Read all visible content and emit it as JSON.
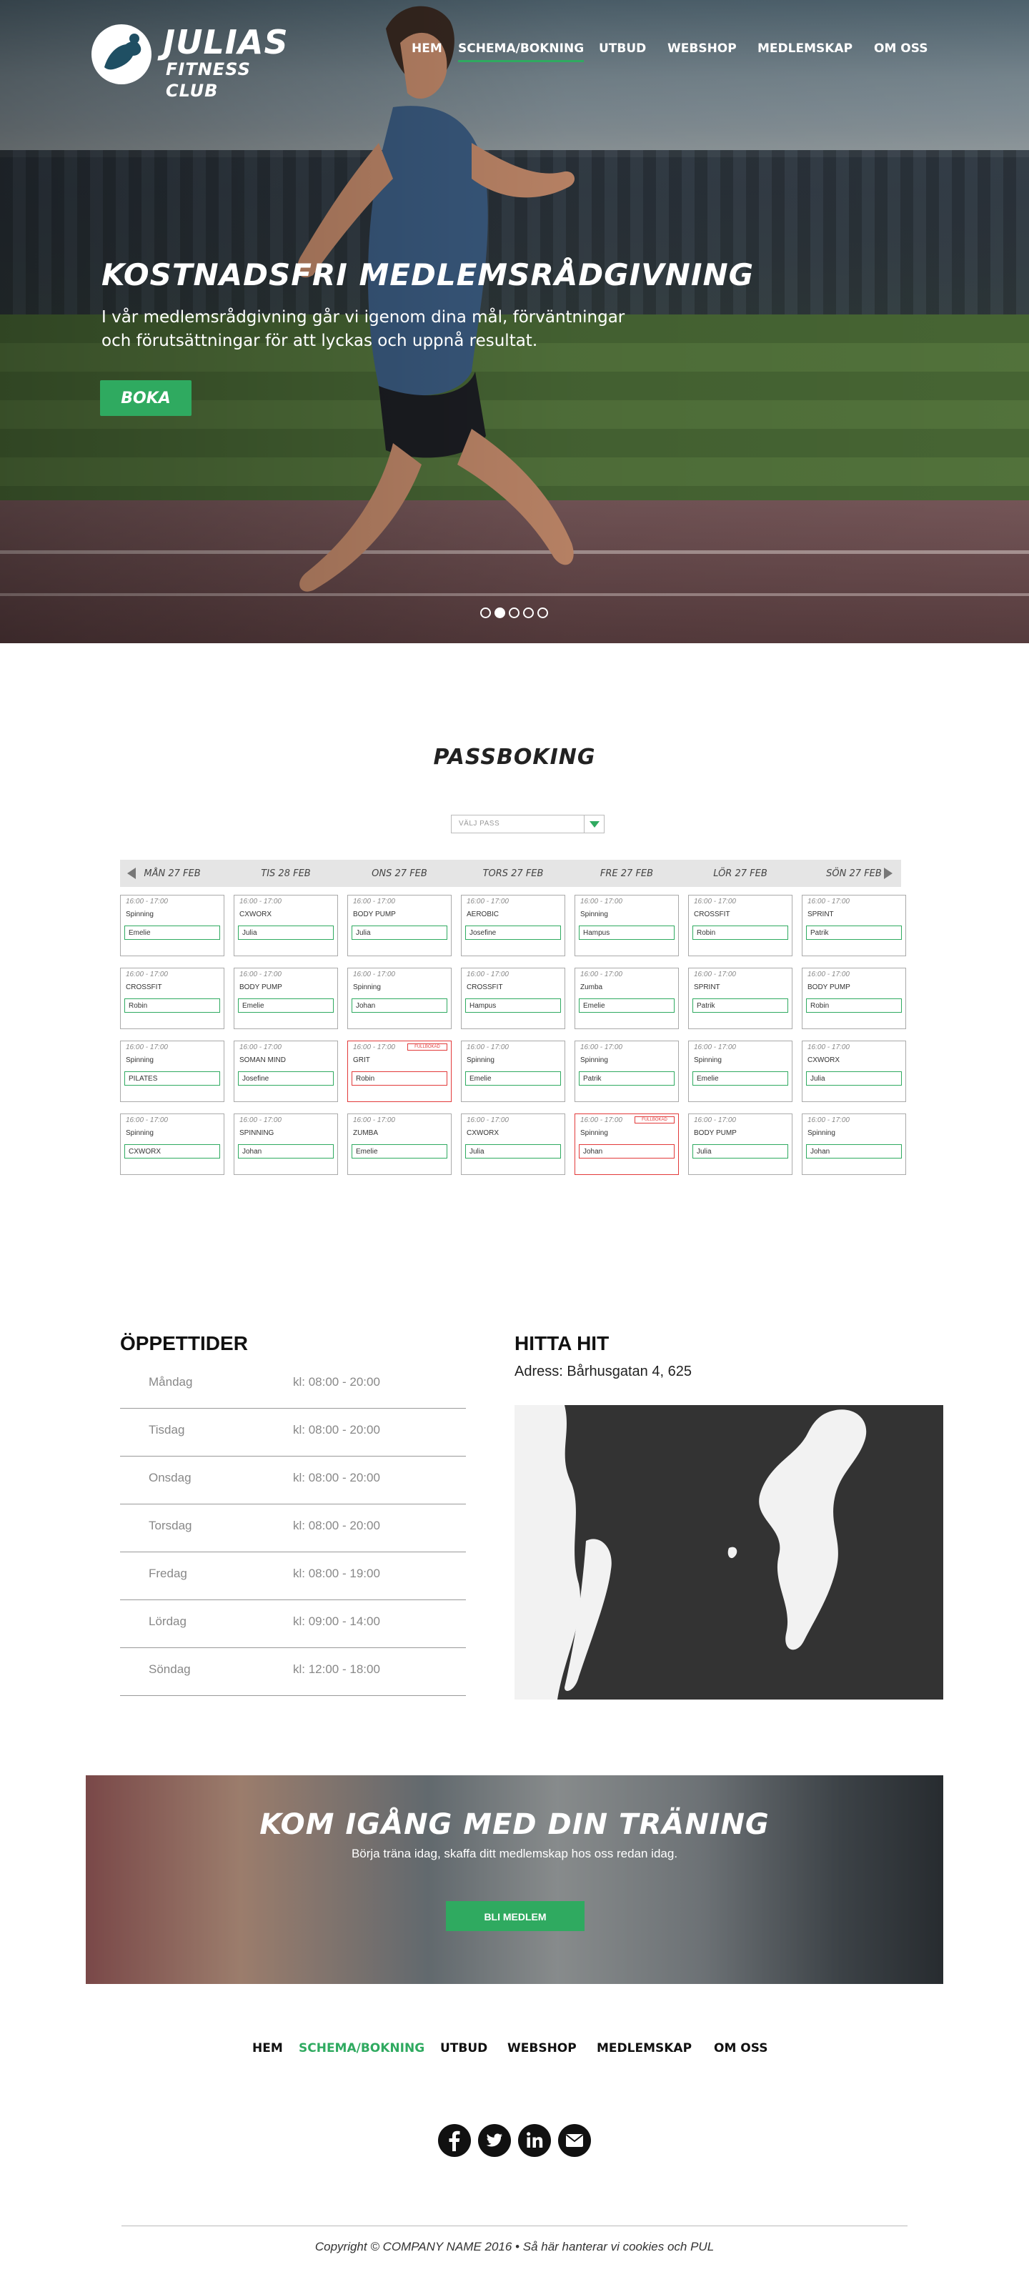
{
  "brand": {
    "title": "JULIAS",
    "subtitle": "FITNESS CLUB"
  },
  "nav": [
    "HEM",
    "SCHEMA/BOKNING",
    "UTBUD",
    "WEBSHOP",
    "MEDLEMSKAP",
    "OM OSS"
  ],
  "hero": {
    "title": "KOSTNADSFRI MEDLEMSRÅDGIVNING",
    "text": "I vår medlemsrådgivning går vi igenom dina mål, förväntningar och förutsättningar för att lyckas och uppnå resultat.",
    "button": "BOKA",
    "slides": 5,
    "active_slide": 2
  },
  "booking": {
    "title": "PASSBOKING",
    "select_placeholder": "VÄLJ PASS",
    "days": [
      "MÅN 27 FEB",
      "TIS 28 FEB",
      "ONS 27 FEB",
      "TORS 27 FEB",
      "FRE 27 FEB",
      "LÖR 27 FEB",
      "SÖN 27 FEB"
    ],
    "full_label": "FULLBOKAD",
    "rows": [
      [
        {
          "time": "16:00 - 17:00",
          "name": "Spinning",
          "trainer": "Emelie"
        },
        {
          "time": "16:00 - 17:00",
          "name": "CXWORX",
          "trainer": "Julia"
        },
        {
          "time": "16:00 - 17:00",
          "name": "BODY PUMP",
          "trainer": "Julia"
        },
        {
          "time": "16:00 - 17:00",
          "name": "AEROBIC",
          "trainer": "Josefine"
        },
        {
          "time": "16:00 - 17:00",
          "name": "Spinning",
          "trainer": "Hampus"
        },
        {
          "time": "16:00 - 17:00",
          "name": "CROSSFIT",
          "trainer": "Robin"
        },
        {
          "time": "16:00 - 17:00",
          "name": "SPRINT",
          "trainer": "Patrik"
        }
      ],
      [
        {
          "time": "16:00 - 17:00",
          "name": "CROSSFIT",
          "trainer": "Robin"
        },
        {
          "time": "16:00 - 17:00",
          "name": "BODY PUMP",
          "trainer": "Emelie"
        },
        {
          "time": "16:00 - 17:00",
          "name": "Spinning",
          "trainer": "Johan"
        },
        {
          "time": "16:00 - 17:00",
          "name": "CROSSFIT",
          "trainer": "Hampus"
        },
        {
          "time": "16:00 - 17:00",
          "name": "Zumba",
          "trainer": "Emelie"
        },
        {
          "time": "16:00 - 17:00",
          "name": "SPRINT",
          "trainer": "Patrik"
        },
        {
          "time": "16:00 - 17:00",
          "name": "BODY PUMP",
          "trainer": "Robin"
        }
      ],
      [
        {
          "time": "16:00 - 17:00",
          "name": "Spinning",
          "trainer": "PILATES"
        },
        {
          "time": "16:00 - 17:00",
          "name": "SOMAN MIND",
          "trainer": "Josefine"
        },
        {
          "time": "16:00 - 17:00",
          "name": "GRIT",
          "trainer": "Robin",
          "full": true
        },
        {
          "time": "16:00 - 17:00",
          "name": "Spinning",
          "trainer": "Emelie"
        },
        {
          "time": "16:00 - 17:00",
          "name": "Spinning",
          "trainer": "Patrik"
        },
        {
          "time": "16:00 - 17:00",
          "name": "Spinning",
          "trainer": "Emelie"
        },
        {
          "time": "16:00 - 17:00",
          "name": "CXWORX",
          "trainer": "Julia"
        }
      ],
      [
        {
          "time": "16:00 - 17:00",
          "name": "Spinning",
          "trainer": "CXWORX"
        },
        {
          "time": "16:00 - 17:00",
          "name": "SPINNING",
          "trainer": "Johan"
        },
        {
          "time": "16:00 - 17:00",
          "name": "ZUMBA",
          "trainer": "Emelie"
        },
        {
          "time": "16:00 - 17:00",
          "name": "CXWORX",
          "trainer": "Julia"
        },
        {
          "time": "16:00 - 17:00",
          "name": "Spinning",
          "trainer": "Johan",
          "full": true
        },
        {
          "time": "16:00 - 17:00",
          "name": "BODY PUMP",
          "trainer": "Julia"
        },
        {
          "time": "16:00 - 17:00",
          "name": "Spinning",
          "trainer": "Johan"
        }
      ]
    ]
  },
  "hours": {
    "title": "ÖPPETTIDER",
    "rows": [
      {
        "day": "Måndag",
        "time": "kl: 08:00 - 20:00"
      },
      {
        "day": "Tisdag",
        "time": "kl: 08:00 - 20:00"
      },
      {
        "day": "Onsdag",
        "time": "kl: 08:00 - 20:00"
      },
      {
        "day": "Torsdag",
        "time": "kl: 08:00 - 20:00"
      },
      {
        "day": "Fredag",
        "time": "kl: 08:00 - 19:00"
      },
      {
        "day": "Lördag",
        "time": "kl: 09:00 - 14:00"
      },
      {
        "day": "Söndag",
        "time": "kl: 12:00 - 18:00"
      }
    ]
  },
  "location": {
    "title": "HITTA HIT",
    "address": "Adress: Bårhusgatan 4, 625"
  },
  "cta": {
    "title": "KOM IGÅNG MED DIN TRÄNING",
    "subtitle": "Börja träna idag, skaffa ditt medlemskap hos oss redan idag.",
    "button": "BLI MEDLEM"
  },
  "footer": {
    "nav": [
      "HEM",
      "SCHEMA/BOKNING",
      "UTBUD",
      "WEBSHOP",
      "MEDLEMSKAP",
      "OM OSS"
    ],
    "social": [
      "facebook-icon",
      "twitter-icon",
      "linkedin-icon",
      "email-icon"
    ],
    "copyright": "Copyright © COMPANY NAME 2016 • Så här hanterar vi cookies och PUL"
  },
  "colors": {
    "accent": "#2faa60",
    "full": "#e23a3a",
    "map_bg": "#333333"
  }
}
